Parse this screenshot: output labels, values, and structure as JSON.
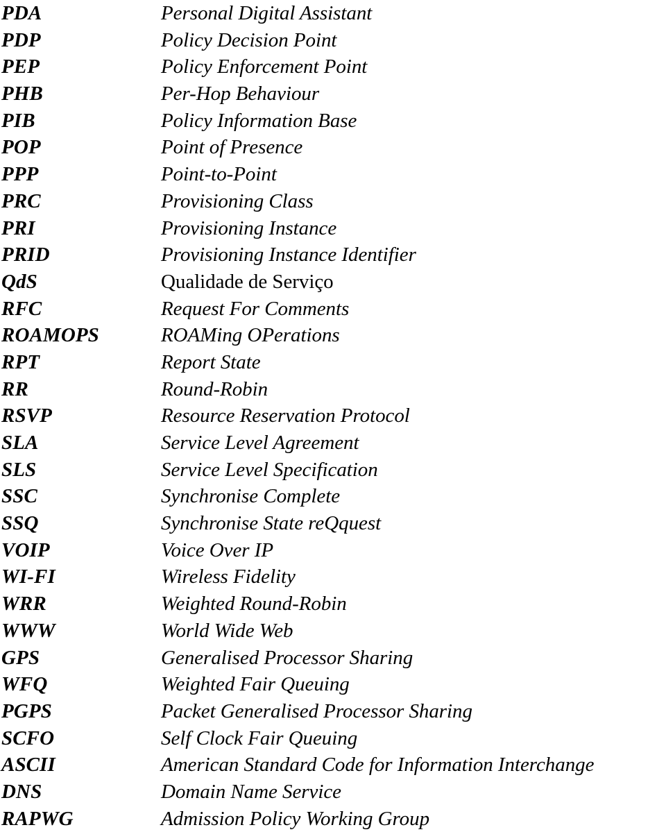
{
  "document": {
    "type": "abbreviations-glossary",
    "columns": {
      "abbreviation_header": "",
      "expansion_header": ""
    },
    "entries": [
      {
        "abbr": "PDA",
        "expansion": "Personal Digital Assistant",
        "style": "italic"
      },
      {
        "abbr": "PDP",
        "expansion": "Policy Decision Point",
        "style": "italic"
      },
      {
        "abbr": "PEP",
        "expansion": "Policy Enforcement Point",
        "style": "italic"
      },
      {
        "abbr": "PHB",
        "expansion": "Per-Hop Behaviour",
        "style": "italic"
      },
      {
        "abbr": "PIB",
        "expansion": "Policy Information Base",
        "style": "italic"
      },
      {
        "abbr": "POP",
        "expansion": "Point of Presence",
        "style": "italic"
      },
      {
        "abbr": "PPP",
        "expansion": "Point-to-Point",
        "style": "italic"
      },
      {
        "abbr": "PRC",
        "expansion": "Provisioning Class",
        "style": "italic"
      },
      {
        "abbr": "PRI",
        "expansion": "Provisioning Instance",
        "style": "italic"
      },
      {
        "abbr": "PRID",
        "expansion": "Provisioning Instance Identifier",
        "style": "italic"
      },
      {
        "abbr": "QdS",
        "expansion": "Qualidade de Serviço",
        "style": "roman"
      },
      {
        "abbr": "RFC",
        "expansion": "Request For Comments",
        "style": "italic"
      },
      {
        "abbr": "ROAMOPS",
        "expansion": "ROAMing OPerations",
        "style": "italic"
      },
      {
        "abbr": "RPT",
        "expansion": "Report State",
        "style": "italic"
      },
      {
        "abbr": "RR",
        "expansion": "Round-Robin",
        "style": "italic"
      },
      {
        "abbr": "RSVP",
        "expansion": "Resource Reservation Protocol",
        "style": "italic"
      },
      {
        "abbr": "SLA",
        "expansion": "Service Level Agreement",
        "style": "italic"
      },
      {
        "abbr": "SLS",
        "expansion": "Service Level Specification",
        "style": "italic"
      },
      {
        "abbr": "SSC",
        "expansion": "Synchronise Complete",
        "style": "italic"
      },
      {
        "abbr": "SSQ",
        "expansion": "Synchronise State reQquest",
        "style": "italic"
      },
      {
        "abbr": "VOIP",
        "expansion": "Voice Over IP",
        "style": "italic"
      },
      {
        "abbr": "WI-FI",
        "expansion": "Wireless Fidelity",
        "style": "italic"
      },
      {
        "abbr": "WRR",
        "expansion": "Weighted Round-Robin",
        "style": "italic"
      },
      {
        "abbr": "WWW",
        "expansion": "World Wide Web",
        "style": "italic"
      },
      {
        "abbr": "GPS",
        "expansion": "Generalised Processor Sharing",
        "style": "italic"
      },
      {
        "abbr": "WFQ",
        "expansion": "Weighted Fair Queuing",
        "style": "italic"
      },
      {
        "abbr": "PGPS",
        "expansion": "Packet Generalised Processor Sharing",
        "style": "italic"
      },
      {
        "abbr": "SCFO",
        "expansion": "Self Clock Fair Queuing",
        "style": "italic"
      },
      {
        "abbr": "ASCII",
        "expansion": "American Standard Code for Information Interchange",
        "style": "italic"
      },
      {
        "abbr": "DNS",
        "expansion": "Domain Name Service",
        "style": "italic"
      },
      {
        "abbr": "RAPWG",
        "expansion": "Admission Policy Working Group",
        "style": "italic"
      }
    ]
  },
  "colors": {
    "text": "#000000",
    "background": "#ffffff"
  }
}
